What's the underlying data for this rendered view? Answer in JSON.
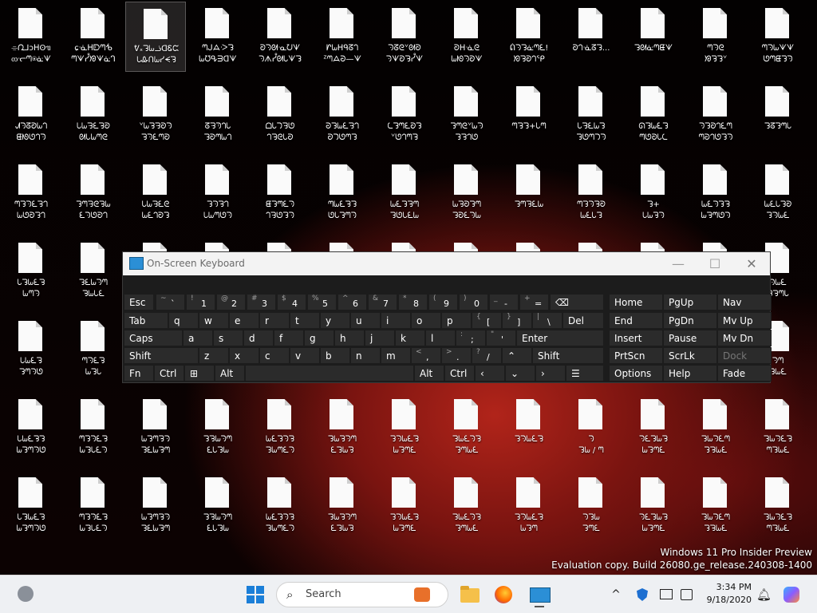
{
  "desktop": {
    "rows": [
      [
        "⌯ᘩ⅃ɔᕼʘᥓ\nᦎᓞᘉ⍟ᓎᗐ",
        "ɕᓍᕼᗟᘉᕺ\nᘉᗐᓮᘟᗐᓎᒉ",
        "ᕓ᙮ᘊᘈᓘᗡᏋᙅ\nᘂᎲᑎᘈᓯᗕᘋ",
        "ᘉᒍᗋᑀᘊ\nᘈᘮᕴᗱᗡᗐ",
        "ᘐᘆᘛᓋᘢᗐ\nᘆᗑᓮᘛᘂᗐᘊ",
        "ᗁᘈᕼᑫᘔᘃ\nᙆᘉᗋᘒ—ᗐ",
        "ᘆᘔᘓᘁᘛᘐ\nᘆᗐᘐᘋᓮᗐ",
        "ᘐᕼᓍᘓ\nᘈᘚᘆᘐᗐ",
        "ᕢᘆᘊᓎᘉᘍ!\nᘞᘋᘐᘃᕿ",
        "ᘐᘃᓍᘔᘊ...",
        "ᘊᘛᓎᘉᘀᗐ",
        "ᘉᘆᘓ\nᘟᘋᘊᘁ",
        "ᘉᘆᘈᗐᗐ\nᘎᘉᘀᘊᘆ"
      ],
      [
        "ᗂᘆᘔᘑᘈᘃ\nᘀᘚᘎᘃᘆ",
        "ᘂᘈᘌᘍᘋᘐ\nᘛᘂᘈᘉᘓ",
        "ᘁᘈᘋᘌᘐᘆ\nᘋᘆᘍᘉᘐ",
        "ᘔᘌᘅᘃᘂ\nᘊᘐᘉᘈᘃ",
        "ᗝᘂᘄᘌᘎ\nᘃᘋᘓᘂᘐ",
        "ᘒᘊᘈᘍᘌᘃ\nᘐᘄᘎᘉᘊ",
        "ᘇᘊᘉᘍᘐᘊ\nᘁᘎᘃᘉᘋ",
        "ᘊᘉᘓᘁᘈᘆ\nᘊᘋᘃᘎ",
        "ᘉᘋᘊ+ᘂᘉ",
        "ᘂᘌᘍᘈᘊ\nᘊᘎᘉᘄᘆ",
        "ᘏᘊᘈᘍᘊ\nᘉᘎᘐᘂᘇ",
        "ᘆᘊᘐᘃᘍᘉ\nᘉᘒᘃᘎᘊᘆ",
        "ᘊᘔᘊᘉᘂ"
      ],
      [
        "ᘉᘊᘆᘍᘋᘃ\nᘈᘎᘐᘊᘃ",
        "ᘊᘉᘌᘓᘋᘈ\nᘍᘆᘎᘐᘃ",
        "ᘂᘈᘌᘍᘓ\nᘈᘍᘃᘐᘊ",
        "ᘊᘆᘋᘃ\nᘂᘈᘉᘎᘆ",
        "ᘀᘊᘉᘍᘆ\nᘃᘌᘎᘊᘆ",
        "ᘉᘈᘍᘋᘊ\nᘎᘂᘊᘉᘆ",
        "ᘈᘍᘊᘋᘉ\nᘊᘎᘂᘍᘈ",
        "ᘈᘋᘐᘊᘉ\nᘊᘐᘍᘆᘈ",
        "ᘊᘉᘋᘍᘈ",
        "ᘉᘊᘆᘋᘐ\nᘈᘍᘂᘊ",
        "ᘊ+\nᘂᘈᘋᘆ",
        "ᘈᘍᘆᘊᘋ\nᘈᘋᘉᘎᘆ",
        "ᘈᘍᘂᘊᘐ\nᘊᘆᘈᘍ"
      ],
      [
        "ᘂᘊᘈᘍᘋ\nᘈᘉᘆ",
        "ᘊᘍᘈᘆᘉ\nᘋᘈᘂᘍ",
        "",
        "",
        "",
        "",
        "",
        "",
        "",
        "",
        "",
        "",
        "ᘆᘈᘍ\nᘊᘋᘉᘂ"
      ],
      [
        "ᘂᘈᘍᘋ\nᘊᘉᘆᘎ",
        "ᘉᘆᘍᘋ\nᘈᘊᘂ",
        "",
        "",
        "",
        "",
        "",
        "",
        "",
        "",
        "",
        "",
        "ᘆᘉ\nᘊᘈᘍ"
      ],
      [
        "ᘂᘈᘍᘋᘊ\nᘈᘊᘉᘆᘎ",
        "ᘉᘊᘆᘍᘋ\nᘈᘊᘂᘍᘆ",
        "ᘈᘊᘉᘋᘆ\nᘊᘍᘈᘋᘉ",
        "ᘊᘋᘈᘆᘉ\nᘍᘂᘊᘈ",
        "ᘈᘍᘊᘆᘋ\nᘊᘈᘉᘍᘆ",
        "ᘊᘈᘋᘆᘉ\nᘍᘊᘈᘋ",
        "ᘊᘆᘈᘍᘋ\nᘈᘊᘉᘍ",
        "ᘊᘈᘍᘆᘋ\nᘊᘉᘈᘍ",
        "ᘊᘆᘈᘍᘋ",
        "ᘆ\nᘊᘈ / ᘉ",
        "ᘆᘍᘊᘈᘋ\nᘈᘊᘉᘍ",
        "ᘊᘈᘆᘍᘉ\nᘊᘋᘈᘍ",
        "ᘊᘈᘆᘍᘋ\nᘉᘊᘈᘍ"
      ],
      [
        "ᘂᘊᘈᘍᘋ\nᘈᘊᘉᘆᘎ",
        "ᘉᘊᘆᘍᘋ\nᘈᘊᘂᘍᘆ",
        "ᘈᘊᘉᘋᘆ\nᘊᘍᘈᘋᘉ",
        "ᘊᘋᘈᘆᘉ\nᘍᘂᘊᘈ",
        "ᘈᘍᘊᘆᘋ\nᘊᘈᘉᘍᘆ",
        "ᘊᘈᘋᘆᘉ\nᘍᘊᘈᘋ",
        "ᘊᘆᘈᘍᘋ\nᘈᘊᘉᘍ",
        "ᘊᘈᘍᘆᘋ\nᘊᘉᘈᘍ",
        "ᘊᘆᘈᘍᘋ\nᘈᘊᘉ",
        "ᘆᘊᘈ\nᘊᘉᘍ",
        "ᘆᘍᘊᘈᘋ\nᘈᘊᘉᘍ",
        "ᘊᘈᘆᘍᘉ\nᘊᘋᘈᘍ",
        "ᘊᘈᘆᘍᘋ\nᘉᘊᘈᘍ"
      ]
    ]
  },
  "watermark": {
    "line1": "Windows 11 Pro Insider Preview",
    "line2": "Evaluation copy. Build 26080.ge_release.240308-1400"
  },
  "osk": {
    "title": "On-Screen Keyboard",
    "minimize": "—",
    "maximize": "☐",
    "close": "✕",
    "keys": {
      "esc": "Esc",
      "tilde_shift": "~",
      "tilde": "`",
      "n1s": "!",
      "n1": "1",
      "n2s": "@",
      "n2": "2",
      "n3s": "#",
      "n3": "3",
      "n4s": "$",
      "n4": "4",
      "n5s": "%",
      "n5": "5",
      "n6s": "^",
      "n6": "6",
      "n7s": "&",
      "n7": "7",
      "n8s": "*",
      "n8": "8",
      "n9s": "(",
      "n9": "9",
      "n0s": ")",
      "n0": "0",
      "minus_s": "_",
      "minus": "-",
      "plus_s": "+",
      "plus": "=",
      "backspace": "⌫",
      "tab": "Tab",
      "q": "q",
      "w": "w",
      "e": "e",
      "r": "r",
      "t": "t",
      "y": "y",
      "u": "u",
      "i": "i",
      "o": "o",
      "p": "p",
      "lb_s": "{",
      "lb": "[",
      "rb_s": "}",
      "rb": "]",
      "bs_s": "|",
      "bs": "\\",
      "del": "Del",
      "caps": "Caps",
      "a": "a",
      "s": "s",
      "d": "d",
      "f": "f",
      "g": "g",
      "h": "h",
      "j": "j",
      "k": "k",
      "l": "l",
      "semi_s": ":",
      "semi": ";",
      "quote_s": "\"",
      "quote": "'",
      "enter": "Enter",
      "shift": "Shift",
      "z": "z",
      "x": "x",
      "c": "c",
      "v": "v",
      "b": "b",
      "n": "n",
      "m": "m",
      "comma_s": "<",
      "comma": ",",
      "dot_s": ">",
      "dot": ".",
      "slash_s": "?",
      "slash": "/",
      "up": "⌃",
      "shift_r": "Shift",
      "fn": "Fn",
      "ctrl": "Ctrl",
      "win": "⊞",
      "alt": "Alt",
      "alt_r": "Alt",
      "ctrl_r": "Ctrl",
      "left": "‹",
      "down": "⌄",
      "right": "›",
      "menu": "☰",
      "home": "Home",
      "pgup": "PgUp",
      "nav": "Nav",
      "end": "End",
      "pgdn": "PgDn",
      "mvup": "Mv Up",
      "insert": "Insert",
      "pause": "Pause",
      "mvdn": "Mv Dn",
      "prtscn": "PrtScn",
      "scrlk": "ScrLk",
      "dock": "Dock",
      "options": "Options",
      "help": "Help",
      "fade": "Fade"
    }
  },
  "taskbar": {
    "search_label": "Search",
    "time": "3:34 PM",
    "date": "9/18/2020",
    "tray_chevron": "^"
  }
}
